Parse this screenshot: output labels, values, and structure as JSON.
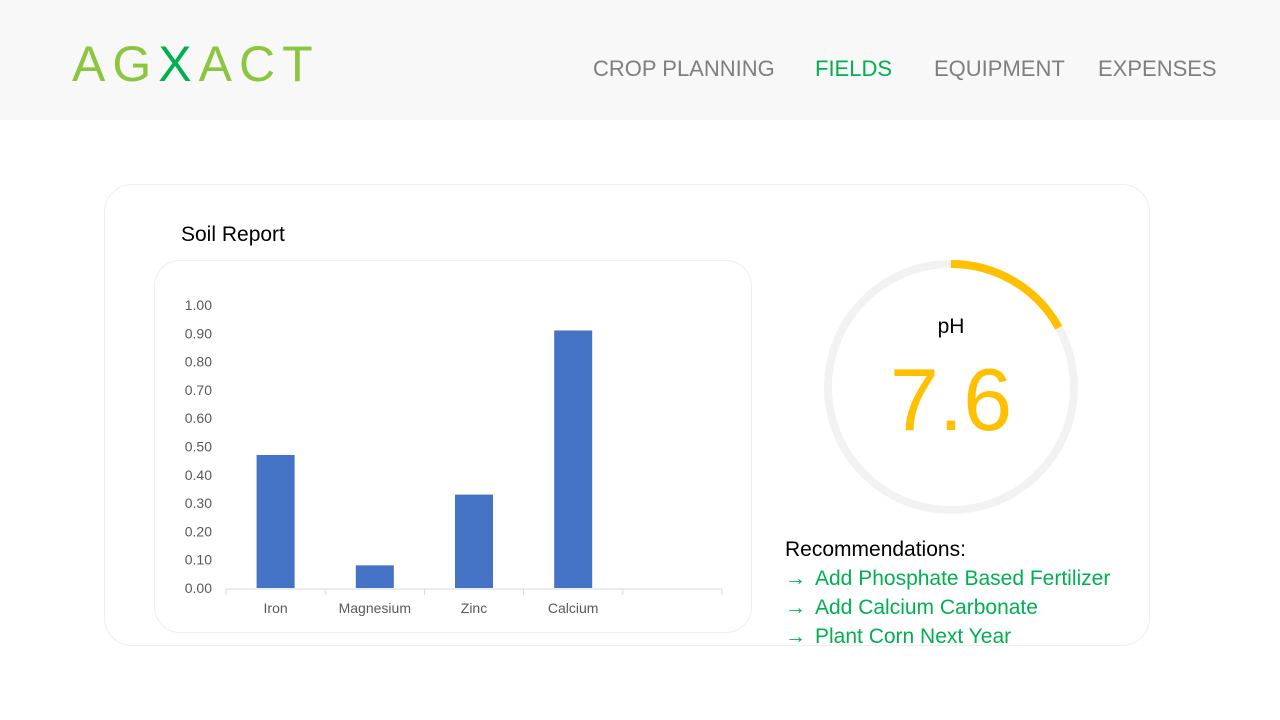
{
  "brand": {
    "logo_prefix": "AG",
    "logo_x": "X",
    "logo_suffix": "ACT"
  },
  "nav": {
    "items": [
      {
        "label": "CROP PLANNING",
        "active": false
      },
      {
        "label": "FIELDS",
        "active": true
      },
      {
        "label": "EQUIPMENT",
        "active": false
      },
      {
        "label": "EXPENSES",
        "active": false
      }
    ]
  },
  "report": {
    "title": "Soil Report"
  },
  "chart_data": {
    "type": "bar",
    "categories": [
      "Iron",
      "Magnesium",
      "Zinc",
      "Calcium",
      ""
    ],
    "series": [
      {
        "values": [
          0.47,
          0.08,
          0.33,
          0.91,
          null
        ],
        "color": "#4472c4"
      }
    ],
    "ylim": [
      0,
      1
    ],
    "yticks": [
      "0.00",
      "0.10",
      "0.20",
      "0.30",
      "0.40",
      "0.50",
      "0.60",
      "0.70",
      "0.80",
      "0.90",
      "1.00"
    ],
    "title": "",
    "xlabel": "",
    "ylabel": "",
    "grid": false,
    "legend": "none"
  },
  "ph": {
    "label": "pH",
    "value": "7.6",
    "gauge_fraction": 0.17,
    "gauge_color": "#ffc000",
    "track_color": "#f2f2f2"
  },
  "recommendations": {
    "title": "Recommendations:",
    "arrow": "→",
    "items": [
      "Add Phosphate Based Fertilizer",
      "Add Calcium Carbonate",
      "Plant Corn Next Year"
    ]
  },
  "colors": {
    "accent": "#00b050",
    "logo": "#8cc63f",
    "nav": "#7f7f7f",
    "bar": "#4472c4",
    "gauge": "#ffc000"
  }
}
